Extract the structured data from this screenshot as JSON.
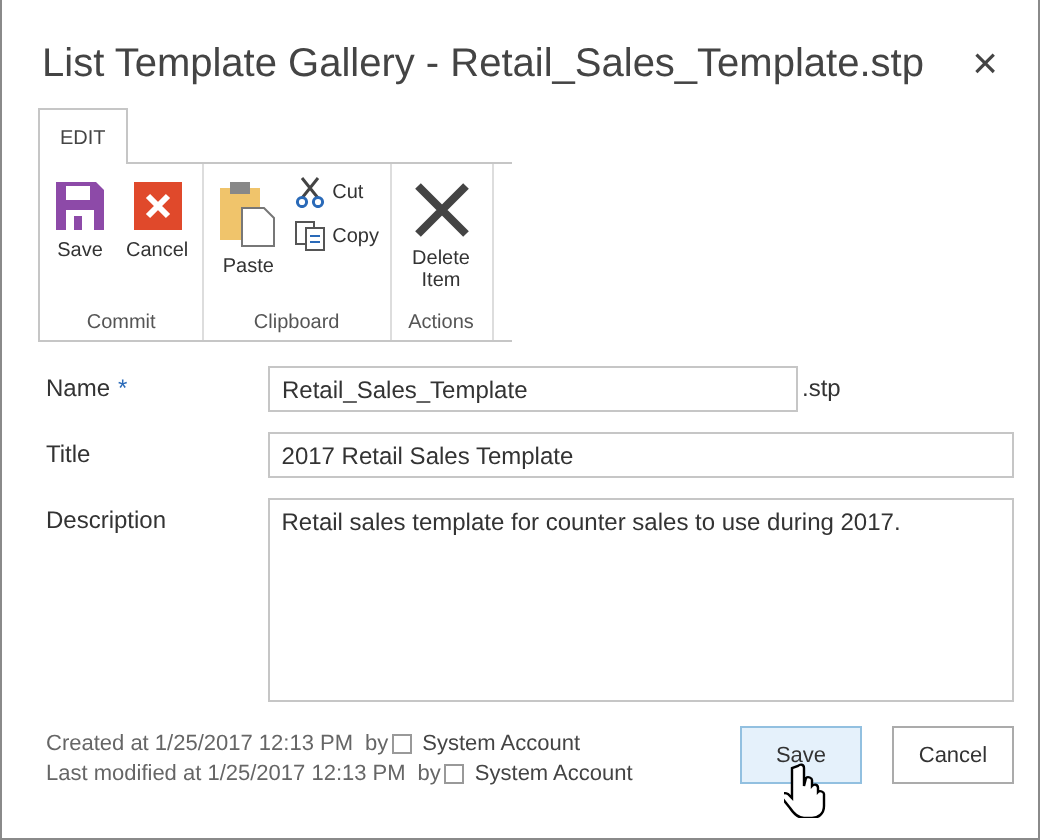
{
  "dialog": {
    "title": "List Template Gallery - Retail_Sales_Template.stp",
    "close": "×"
  },
  "tabs": [
    {
      "label": "EDIT",
      "selected": true
    }
  ],
  "ribbon": {
    "groups": [
      {
        "label": "Commit",
        "items": [
          {
            "label": "Save",
            "kind": "large"
          },
          {
            "label": "Cancel",
            "kind": "large"
          }
        ]
      },
      {
        "label": "Clipboard",
        "items": [
          {
            "label": "Paste",
            "kind": "large"
          },
          {
            "label": "Cut",
            "kind": "small"
          },
          {
            "label": "Copy",
            "kind": "small"
          }
        ]
      },
      {
        "label": "Actions",
        "items": [
          {
            "label": "Delete Item",
            "kind": "large"
          }
        ]
      }
    ]
  },
  "fields": [
    {
      "label": "Name",
      "required_mark": "*",
      "kind": "input",
      "value": "Retail_Sales_Template",
      "suffix": ".stp"
    },
    {
      "label": "Title",
      "kind": "input",
      "value": "2017 Retail Sales Template"
    },
    {
      "label": "Description",
      "kind": "textarea",
      "value": "Retail sales template for counter sales to use during 2017."
    }
  ],
  "footer": {
    "lines": [
      {
        "text": "Created at 1/25/2017 12:13 PM",
        "by": "by",
        "user": "System Account"
      },
      {
        "text": "Last modified at 1/25/2017 12:13 PM",
        "by": "by",
        "user": "System Account"
      }
    ]
  },
  "buttons": [
    {
      "label": "Save",
      "highlighted": true
    },
    {
      "label": "Cancel",
      "highlighted": false
    }
  ]
}
